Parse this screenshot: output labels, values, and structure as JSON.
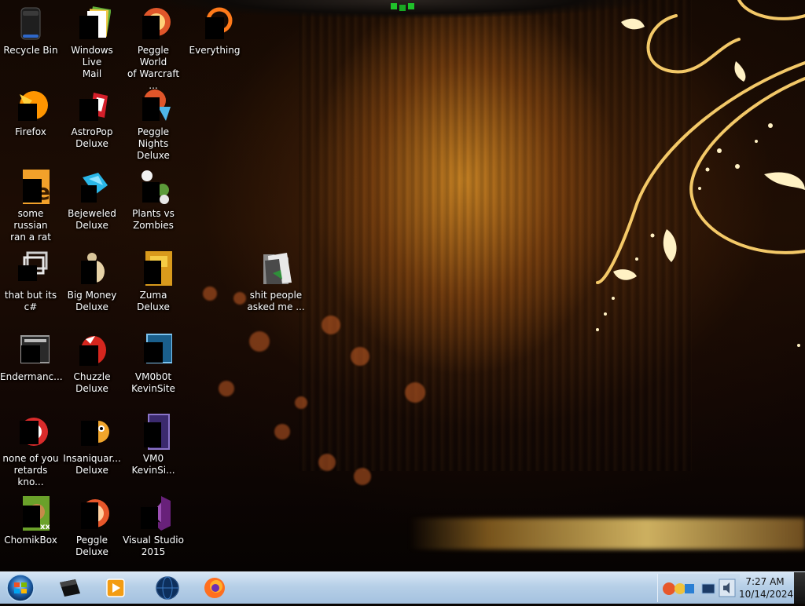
{
  "desktop_icons": [
    {
      "name": "recycle-bin-icon",
      "label": "Recycle Bin"
    },
    {
      "name": "windows-live-mail-icon",
      "label": "Windows Live\nMail"
    },
    {
      "name": "peggle-wow-icon",
      "label": "Peggle World\nof Warcraft ..."
    },
    {
      "name": "everything-icon",
      "label": "Everything"
    },
    {
      "name": "firefox-icon",
      "label": "Firefox"
    },
    {
      "name": "astropop-icon",
      "label": "AstroPop\nDeluxe"
    },
    {
      "name": "peggle-nights-icon",
      "label": "Peggle Nights\nDeluxe"
    },
    {
      "name": "some-russian-icon",
      "label": "some russian\nran a rat"
    },
    {
      "name": "bejeweled-icon",
      "label": "Bejeweled\nDeluxe"
    },
    {
      "name": "plants-vs-zombies-icon",
      "label": "Plants vs\nZombies"
    },
    {
      "name": "that-but-its-csharp-icon",
      "label": "that but its c#"
    },
    {
      "name": "big-money-icon",
      "label": "Big Money\nDeluxe"
    },
    {
      "name": "zuma-icon",
      "label": "Zuma Deluxe"
    },
    {
      "name": "folder-icon",
      "label": "shit people\nasked me ..."
    },
    {
      "name": "endermanch-icon",
      "label": "Endermanc..."
    },
    {
      "name": "chuzzle-icon",
      "label": "Chuzzle\nDeluxe"
    },
    {
      "name": "vm0b0t-kevinsite-icon",
      "label": "VM0b0t\nKevinSite"
    },
    {
      "name": "none-of-you-icon",
      "label": "none of you\nretards kno..."
    },
    {
      "name": "insaniquarium-icon",
      "label": "Insaniquar...\nDeluxe"
    },
    {
      "name": "vm0-kevinsite-icon",
      "label": "VM0\nKevinSi..."
    },
    {
      "name": "chomikbox-icon",
      "label": "ChomikBox"
    },
    {
      "name": "peggle-deluxe-icon",
      "label": "Peggle Deluxe"
    },
    {
      "name": "visual-studio-icon",
      "label": "Visual Studio\n2015"
    }
  ],
  "taskbar": {
    "pinned": [
      {
        "name": "terminal-taskbar-icon"
      },
      {
        "name": "media-player-taskbar-icon"
      },
      {
        "name": "globe-taskbar-icon"
      },
      {
        "name": "firefox-taskbar-icon"
      }
    ],
    "clock": {
      "time": "7:27 AM",
      "date": "10/14/2024"
    }
  }
}
